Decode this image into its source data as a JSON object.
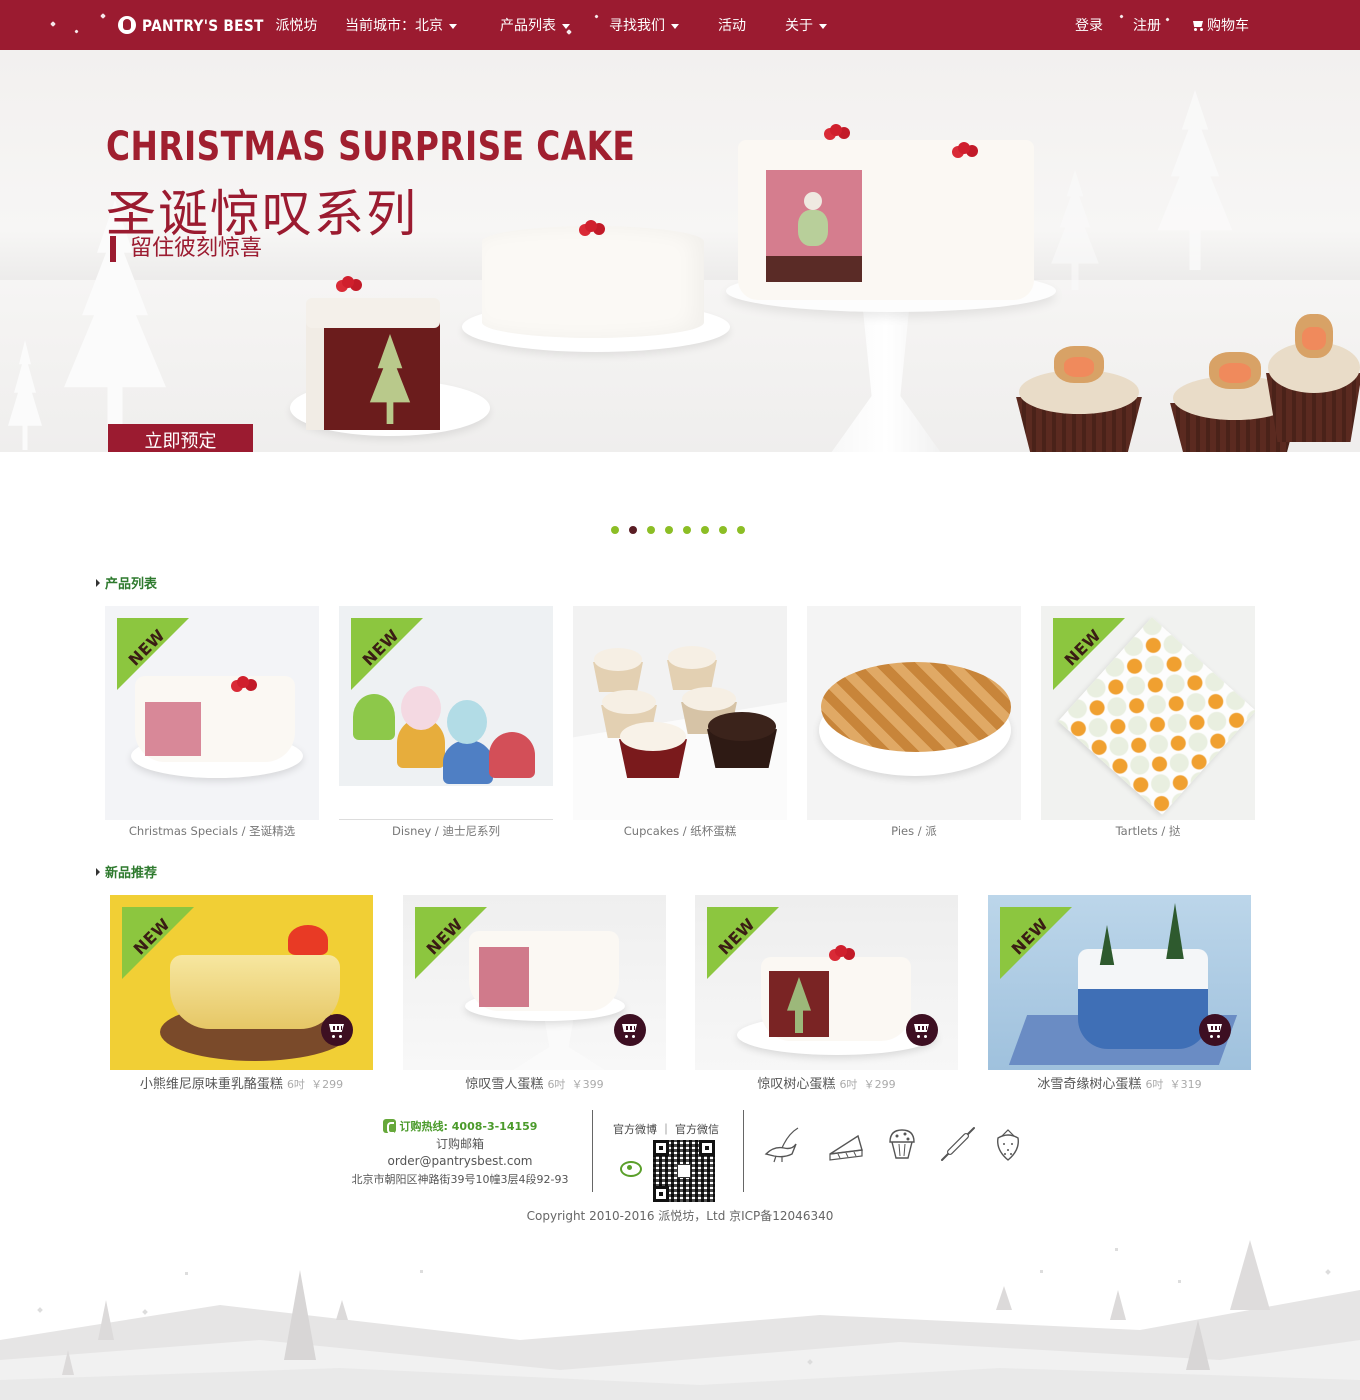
{
  "nav": {
    "brand_en": "PANTRY'S BEST",
    "brand_cn": "派悦坊",
    "city_label": "当前城市：北京",
    "items": [
      {
        "label": "产品列表"
      },
      {
        "label": "寻找我们"
      },
      {
        "label": "活动"
      },
      {
        "label": "关于"
      }
    ],
    "login": "登录",
    "register": "注册",
    "cart": "购物车"
  },
  "hero": {
    "title_en": "CHRISTMAS SURPRISE CAKE",
    "title_cn": "圣诞惊叹系列",
    "subtitle": "留住彼刻惊喜",
    "button": "立即预定"
  },
  "carousel": {
    "count": 8,
    "active_index": 1
  },
  "products": {
    "section_title": "产品列表",
    "items": [
      {
        "label": "Christmas Specials / 圣诞精选",
        "is_new": true
      },
      {
        "label": "Disney / 迪士尼系列",
        "is_new": true
      },
      {
        "label": "Cupcakes / 纸杯蛋糕",
        "is_new": false
      },
      {
        "label": "Pies / 派",
        "is_new": false
      },
      {
        "label": "Tartlets / 挞",
        "is_new": true
      }
    ]
  },
  "new_tag": "NEW",
  "recommended": {
    "section_title": "新品推荐",
    "items": [
      {
        "name": "小熊维尼原味重乳酪蛋糕",
        "size": "6吋",
        "price": "￥299"
      },
      {
        "name": "惊叹雪人蛋糕",
        "size": "6吋",
        "price": "￥399"
      },
      {
        "name": "惊叹树心蛋糕",
        "size": "6吋",
        "price": "￥299"
      },
      {
        "name": "冰雪奇缘树心蛋糕",
        "size": "6吋",
        "price": "￥319"
      }
    ]
  },
  "footer": {
    "hotline": "订购热线: 4008-3-14159",
    "email_label": "订购邮箱",
    "email": "order@pantrysbest.com",
    "address": "北京市朝阳区神路街39号10幢3层4段92-93",
    "social": "官方微博 ｜ 官方微信",
    "copyright": "Copyright 2010-2016 派悦坊，Ltd 京ICP备12046340"
  },
  "colors": {
    "brand": "#9b1b30",
    "accent_green": "#8cc63f",
    "cart_button": "#3d0f22"
  },
  "icons": [
    "phone-icon",
    "weibo-icon",
    "qr-code",
    "bird-branch-icon",
    "pie-slice-icon",
    "muffin-icon",
    "rolling-pin-icon",
    "strawberry-icon",
    "cart-icon"
  ]
}
